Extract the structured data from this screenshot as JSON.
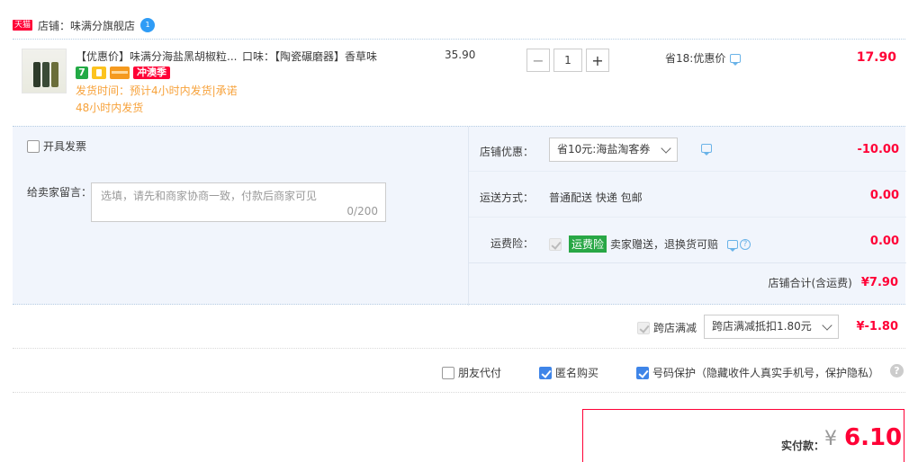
{
  "shop": {
    "badge": "天猫",
    "label": "店铺：味满分旗舰店",
    "ww": "1"
  },
  "item": {
    "title": "【优惠价】味满分海盐黑胡椒粒...",
    "spec": "口味：【陶瓷碾磨器】香草味",
    "badge_7": "7",
    "badge_sale": "冲澳季",
    "ship_note": "发货时间：预计4小时内发货|承诺48小时内发货",
    "price": "35.90",
    "qty": "1",
    "qty_minus": "−",
    "qty_plus": "+",
    "promo": "省18:优惠价",
    "subtotal": "17.90"
  },
  "options": {
    "invoice_label": "开具发票",
    "msg_label": "给卖家留言：",
    "msg_placeholder": "选填，请先和商家协商一致，付款后商家可见",
    "msg_count": "0/200",
    "coupon_label": "店铺优惠：",
    "coupon_value": "省10元:海盐淘客券",
    "coupon_amount": "-10.00",
    "ship_label": "运送方式：",
    "ship_value": "普通配送 快递 包邮",
    "ship_amount": "0.00",
    "ins_label": "运费险：",
    "ins_badge": "运费险",
    "ins_text": "卖家赠送，退换货可赔",
    "ins_help": "?",
    "ins_amount": "0.00",
    "shop_total_label": "店铺合计(含运费)",
    "shop_total_amount": "¥7.90"
  },
  "cross_store": {
    "label": "跨店满减",
    "value": "跨店满减抵扣1.80元",
    "amount": "¥-1.80"
  },
  "extra_options": {
    "friend_pay": "朋友代付",
    "anonymous": "匿名购买",
    "number_protect": "号码保护（隐藏收件人真实手机号，保护隐私）",
    "help": "?"
  },
  "payment": {
    "label": "实付款：",
    "yen": "¥",
    "amount": "6.10"
  },
  "colors": {
    "accent_red": "#ff0036",
    "panel_bg": "#f1f5fc",
    "ship_note": "#f7a23b",
    "insurance_green": "#28a745"
  }
}
